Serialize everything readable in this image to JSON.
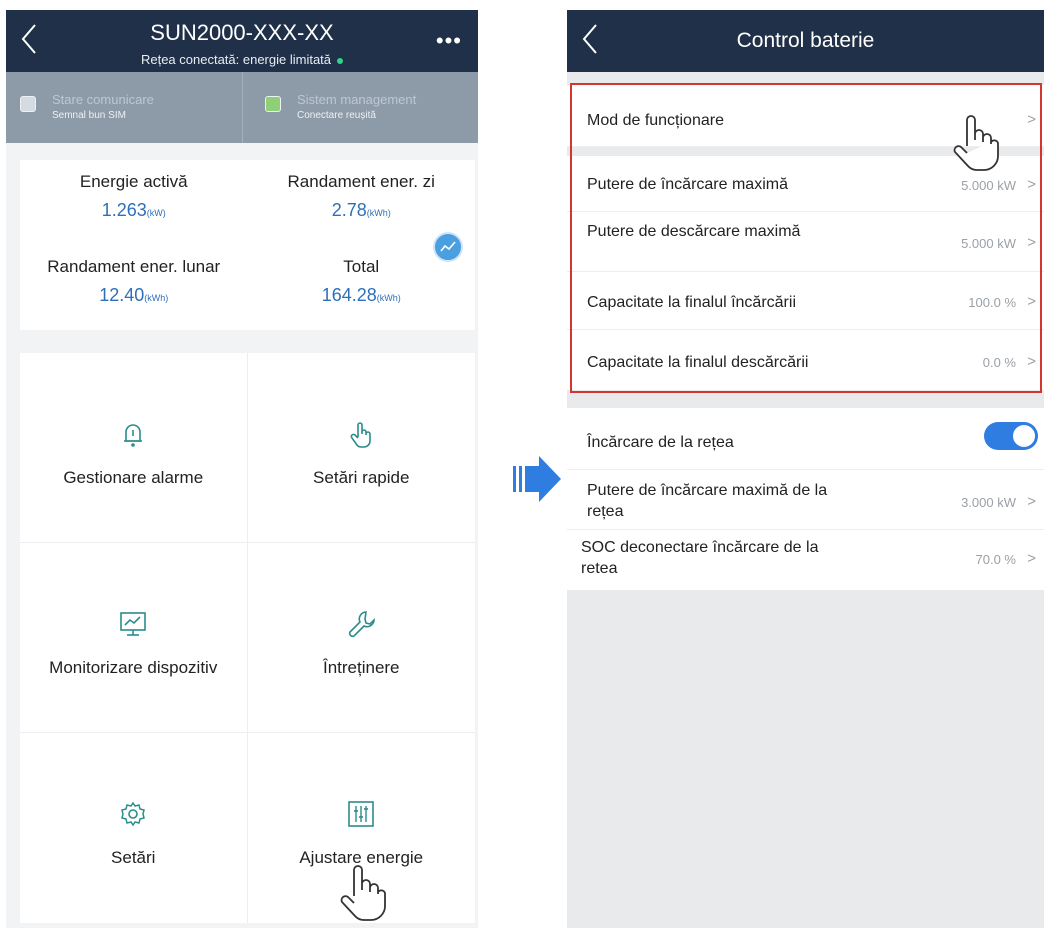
{
  "left_screen": {
    "title": "SUN2000-XXX-XX",
    "subtitle": "Rețea conectată: energie limitată",
    "status": {
      "communication_title": "Stare comunicare",
      "communication_value": "Semnal bun SIM",
      "management_title": "Sistem management",
      "management_value": "Conectare reușită"
    },
    "energy": {
      "active_label": "Energie activă",
      "active_value": "1.263",
      "active_unit": "(kW)",
      "daily_label": "Randament ener. zi",
      "daily_value": "2.78",
      "daily_unit": "(kWh)",
      "monthly_label": "Randament ener. lunar",
      "monthly_value": "12.40",
      "monthly_unit": "(kWh)",
      "total_label": "Total",
      "total_value": "164.28",
      "total_unit": "(kWh)"
    },
    "functions": [
      {
        "label": "Gestionare alarme",
        "icon": "bell-icon"
      },
      {
        "label": "Setări rapide",
        "icon": "hand-pointer-icon"
      },
      {
        "label": "Monitorizare dispozitiv",
        "icon": "monitor-icon"
      },
      {
        "label": "Întreținere",
        "icon": "wrench-icon"
      },
      {
        "label": "Setări",
        "icon": "gear-icon"
      },
      {
        "label": "Ajustare energie",
        "icon": "sliders-icon"
      }
    ]
  },
  "right_screen": {
    "title": "Control baterie",
    "rows": [
      {
        "label": "Mod de funcționare",
        "value": ""
      },
      {
        "label": "Putere de încărcare maximă",
        "value": "5.000 kW"
      },
      {
        "label": "Putere de descărcare maximă",
        "value": "5.000 kW"
      },
      {
        "label": "Capacitate la finalul încărcării",
        "value": "100.0 %"
      },
      {
        "label": "Capacitate la finalul descărcării",
        "value": "0.0 %"
      },
      {
        "label": "Încărcare de la rețea",
        "value": ""
      },
      {
        "label": "Putere de încărcare maximă de la rețea",
        "value": "3.000 kW"
      },
      {
        "label": "SOC deconectare încărcare de la retea",
        "value": "70.0 %"
      }
    ],
    "grid_charge_enabled": true
  },
  "colors": {
    "header": "#1f3048",
    "status_strip": "#8d9aa8",
    "accent_blue": "#2f6fb8",
    "highlight_red": "#d2362f",
    "toggle_on": "#2f7de1"
  }
}
